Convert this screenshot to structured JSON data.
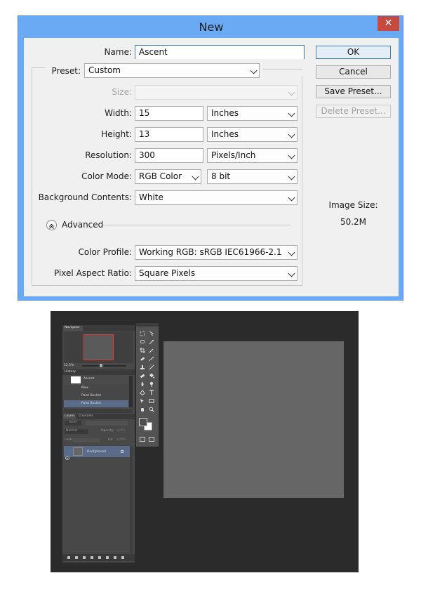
{
  "dialog": {
    "title": "New",
    "close_glyph": "✕",
    "name_label": "Name:",
    "name_value": "Ascent",
    "preset_label": "Preset:",
    "preset_value": "Custom",
    "size_label": "Size:",
    "size_value": "",
    "width_label": "Width:",
    "width_value": "15",
    "width_unit": "Inches",
    "height_label": "Height:",
    "height_value": "13",
    "height_unit": "Inches",
    "resolution_label": "Resolution:",
    "resolution_value": "300",
    "resolution_unit": "Pixels/Inch",
    "color_mode_label": "Color Mode:",
    "color_mode_value": "RGB Color",
    "bit_depth_value": "8 bit",
    "background_label": "Background Contents:",
    "background_value": "White",
    "advanced_label": "Advanced",
    "color_profile_label": "Color Profile:",
    "color_profile_value": "Working RGB:  sRGB IEC61966-2.1",
    "pixel_aspect_label": "Pixel Aspect Ratio:",
    "pixel_aspect_value": "Square Pixels",
    "image_size_label": "Image Size:",
    "image_size_value": "50.2M",
    "buttons": {
      "ok": "OK",
      "cancel": "Cancel",
      "save_preset": "Save Preset...",
      "delete_preset": "Delete Preset..."
    }
  },
  "photoshop": {
    "navigator_tab": "Navigator",
    "zoom": "12.5%",
    "history_tab": "History",
    "history_items": [
      "Ascent",
      "New",
      "Paint Bucket",
      "Paint Bucket"
    ],
    "layers_tab": "Layers",
    "channels_tab": "Channels",
    "kind_filter": "Kind",
    "blend_mode": "Normal",
    "opacity_label": "Opacity:",
    "opacity_value": "100%",
    "lock_label": "Lock:",
    "fill_label": "Fill:",
    "fill_value": "100%",
    "layer_name": "Background",
    "colors": {
      "canvas": "#666666",
      "workspace": "#2b2b2b",
      "panel": "#484848",
      "navigator_frame": "#e03a3a",
      "selected_row": "#5a6c8a"
    }
  }
}
